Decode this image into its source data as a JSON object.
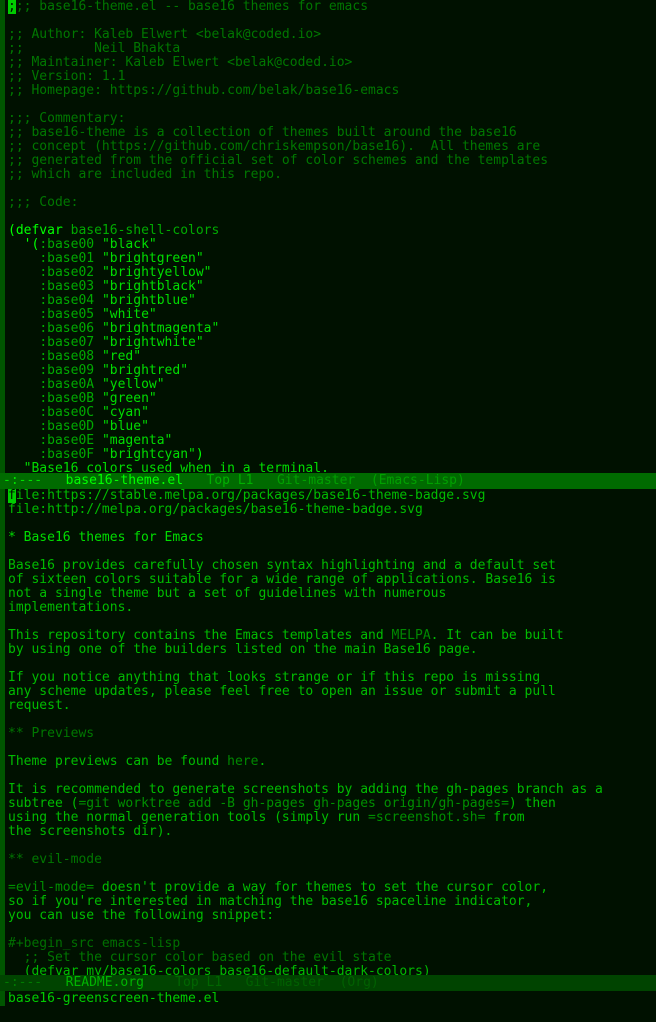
{
  "app": {
    "name": "emacs",
    "theme": "base16-greenscreen"
  },
  "colors": {
    "background": "#001100",
    "foreground": "#00bb00",
    "comment": "#007700",
    "string": "#00dd00",
    "keyword": "#00aa00",
    "modeline_active_bg": "#006b00",
    "modeline_inactive_bg": "#004400",
    "fringe": "#005500",
    "cursor": "#00cc00"
  },
  "top_window": {
    "lines": [
      ";;; base16-theme.el -- base16 themes for emacs",
      "",
      ";; Author: Kaleb Elwert <belak@coded.io>",
      ";;         Neil Bhakta",
      ";; Maintainer: Kaleb Elwert <belak@coded.io>",
      ";; Version: 1.1",
      ";; Homepage: https://github.com/belak/base16-emacs",
      "",
      ";;; Commentary:",
      ";; base16-theme is a collection of themes built around the base16",
      ";; concept (https://github.com/chriskempson/base16).  All themes are",
      ";; generated from the official set of color schemes and the templates",
      ";; which are included in this repo.",
      "",
      ";;; Code:",
      "",
      "(defvar base16-shell-colors",
      "  '(:base00 \"black\"",
      "    :base01 \"brightgreen\"",
      "    :base02 \"brightyellow\"",
      "    :base03 \"brightblack\"",
      "    :base04 \"brightblue\"",
      "    :base05 \"white\"",
      "    :base06 \"brightmagenta\"",
      "    :base07 \"brightwhite\"",
      "    :base08 \"red\"",
      "    :base09 \"brightred\"",
      "    :base0A \"yellow\"",
      "    :base0B \"green\"",
      "    :base0C \"cyan\"",
      "    :base0D \"blue\"",
      "    :base0E \"magenta\"",
      "    :base0F \"brightcyan\")",
      "  \"Base16 colors used when in a terminal."
    ],
    "cursor": {
      "line": 0,
      "column": 0,
      "char": ";"
    },
    "modeline": {
      "status": "-:---",
      "buffer_name": "base16-theme.el",
      "position": "Top L1",
      "vc": "Git-master",
      "major_mode": "(Emacs-Lisp)"
    }
  },
  "bottom_window": {
    "lines": [
      "file:https://stable.melpa.org/packages/base16-theme-badge.svg",
      "file:http://melpa.org/packages/base16-theme-badge.svg",
      "",
      "* Base16 themes for Emacs",
      "",
      "Base16 provides carefully chosen syntax highlighting and a default set",
      "of sixteen colors suitable for a wide range of applications. Base16 is",
      "not a single theme but a set of guidelines with numerous",
      "implementations.",
      "",
      "This repository contains the Emacs templates and MELPA. It can be built",
      "by using one of the builders listed on the main Base16 page.",
      "",
      "If you notice anything that looks strange or if this repo is missing",
      "any scheme updates, please feel free to open an issue or submit a pull",
      "request.",
      "",
      "** Previews",
      "",
      "Theme previews can be found here.",
      "",
      "It is recommended to generate screenshots by adding the gh-pages branch as a",
      "subtree (=git worktree add -B gh-pages gh-pages origin/gh-pages=) then",
      "using the normal generation tools (simply run =screenshot.sh= from",
      "the screenshots dir).",
      "",
      "** evil-mode",
      "",
      "=evil-mode= doesn't provide a way for themes to set the cursor color,",
      "so if you're interested in matching the base16 spaceline indicator,",
      "you can use the following snippet:",
      "",
      "#+begin_src emacs-lisp",
      "  ;; Set the cursor color based on the evil state",
      "  (defvar my/base16-colors base16-default-dark-colors)"
    ],
    "cursor": {
      "line": 0,
      "column": 0,
      "char": "f"
    },
    "modeline": {
      "status": "-:---",
      "buffer_name": "README.org",
      "position": "Top L1",
      "vc": "Git-master",
      "major_mode": "(Org)"
    }
  },
  "minibuffer": {
    "text": "base16-greenscreen-theme.el"
  }
}
